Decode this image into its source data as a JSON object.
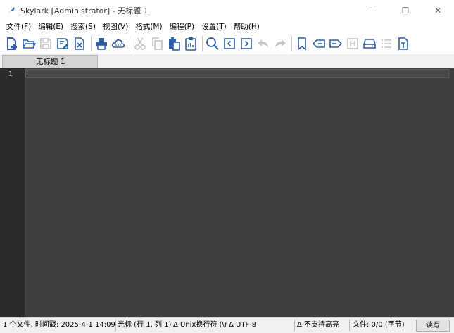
{
  "window": {
    "title": "Skylark [Administrator] - 无标题 1",
    "minimize": "—",
    "maximize": "☐",
    "close": "✕"
  },
  "menu": [
    {
      "label": "文件(F)"
    },
    {
      "label": "编辑(E)"
    },
    {
      "label": "搜索(S)"
    },
    {
      "label": "视图(V)"
    },
    {
      "label": "格式(M)"
    },
    {
      "label": "编程(P)"
    },
    {
      "label": "设置(T)"
    },
    {
      "label": "帮助(H)"
    }
  ],
  "toolbar_icons": [
    "new-file-icon",
    "open-folder-icon",
    "save-icon",
    "save-as-icon",
    "close-file-icon",
    "print-icon",
    "cloud-icon",
    "cut-icon",
    "copy-icon",
    "paste-icon",
    "clipboard-icon",
    "search-icon",
    "prev-icon",
    "next-icon",
    "undo-icon",
    "redo-icon",
    "bookmark-icon",
    "back-icon",
    "forward-icon",
    "hex-icon",
    "drive-icon",
    "list-icon",
    "text-icon"
  ],
  "tab": {
    "label": "无标题 1"
  },
  "editor": {
    "line_number": "1"
  },
  "statusbar": {
    "file_info": "1 个文件, 时间戳: 2025-4-1 14:09",
    "cursor": "光标 (行 1, 列 1)",
    "eol": "Δ Unix换行符 (\\n)",
    "encoding": "Δ UTF-8",
    "highlight": "Δ 不支持高亮",
    "file_size": "文件: 0/0 (字节)",
    "mode": "读写"
  },
  "colors": {
    "accent_blue": "#2f5fa8",
    "editor_bg": "#3f3f3f",
    "gutter_bg": "#2b2b2b"
  }
}
